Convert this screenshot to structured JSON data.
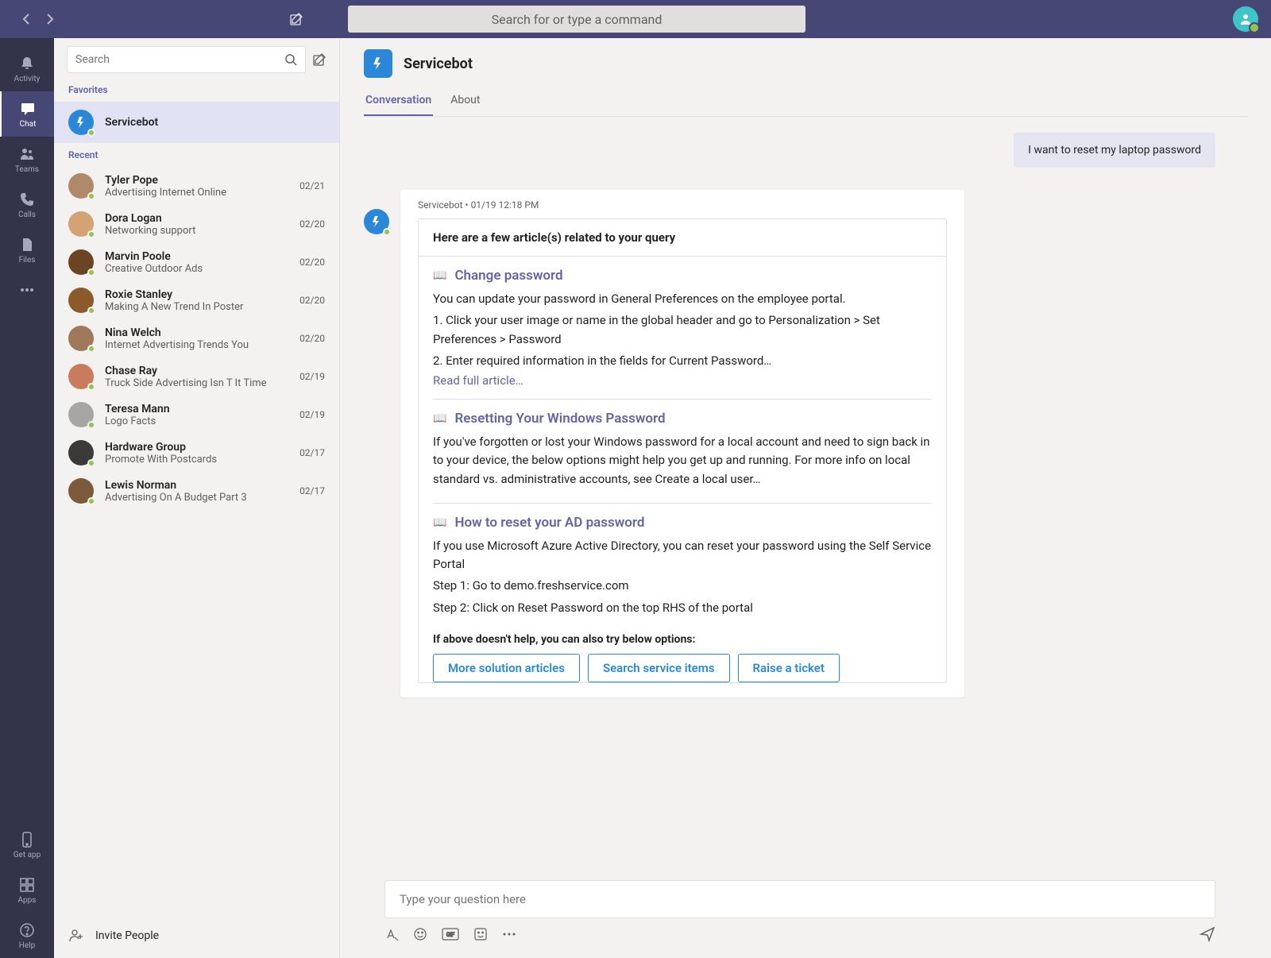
{
  "topbar": {
    "search_placeholder": "Search for or type a command"
  },
  "rail": [
    {
      "id": "activity",
      "label": "Activity"
    },
    {
      "id": "chat",
      "label": "Chat"
    },
    {
      "id": "teams",
      "label": "Teams"
    },
    {
      "id": "calls",
      "label": "Calls"
    },
    {
      "id": "files",
      "label": "Files"
    }
  ],
  "rail_bottom": [
    {
      "id": "getapp",
      "label": "Get app"
    },
    {
      "id": "apps",
      "label": "Apps"
    },
    {
      "id": "help",
      "label": "Help"
    }
  ],
  "chatlist": {
    "search_placeholder": "Search",
    "favorites_label": "Favorites",
    "recent_label": "Recent",
    "favorite": {
      "name": "Servicebot"
    },
    "recents": [
      {
        "name": "Tyler Pope",
        "preview": "Advertising Internet Online",
        "date": "02/21",
        "color": "#b08968"
      },
      {
        "name": "Dora Logan",
        "preview": "Networking support",
        "date": "02/20",
        "color": "#d4a373"
      },
      {
        "name": "Marvin Poole",
        "preview": "Creative Outdoor Ads",
        "date": "02/20",
        "color": "#6b4423"
      },
      {
        "name": "Roxie Stanley",
        "preview": "Making A New Trend In Poster",
        "date": "02/20",
        "color": "#8b5a2b"
      },
      {
        "name": "Nina Welch",
        "preview": "Internet Advertising Trends You",
        "date": "02/20",
        "color": "#a0785a"
      },
      {
        "name": "Chase Ray",
        "preview": "Truck Side Advertising Isn T It Time",
        "date": "02/19",
        "color": "#c97c5d"
      },
      {
        "name": "Teresa Mann",
        "preview": "Logo Facts",
        "date": "02/19",
        "color": "#a6a6a6"
      },
      {
        "name": "Hardware Group",
        "preview": "Promote With Postcards",
        "date": "02/17",
        "color": "#3a3a3a"
      },
      {
        "name": "Lewis Norman",
        "preview": "Advertising On A Budget Part 3",
        "date": "02/17",
        "color": "#7d5a3c"
      }
    ],
    "invite_label": "Invite People"
  },
  "conversation": {
    "title": "Servicebot",
    "tabs": [
      {
        "label": "Conversation",
        "active": true
      },
      {
        "label": "About",
        "active": false
      }
    ],
    "user_message": "I want to reset my laptop password",
    "bot_meta_name": "Servicebot",
    "bot_meta_time": "01/19 12:18 PM",
    "card_header": "Here are a few article(s) related to your query",
    "articles": [
      {
        "title": "Change password",
        "lines": [
          "You can update your password in General Preferences on the employee portal.",
          "1. Click your user image or name in the global header and go to Personalization > Set Preferences > Password",
          "2. Enter required information in the fields for Current Password…"
        ],
        "read_more": "Read full article…"
      },
      {
        "title": "Resetting Your Windows Password",
        "lines": [
          "If you've forgotten or lost your Windows password for a local account and need to sign back in to your device, the below options might help you get up and running. For more info on local standard vs. administrative accounts, see Create a local user…"
        ]
      },
      {
        "title": "How to reset your AD password",
        "lines": [
          "If you use Microsoft Azure Active Directory, you can reset your password using the Self Service Portal",
          "Step 1: Go to demo.freshservice.com",
          "Step 2: Click on Reset Password on the top RHS of the portal"
        ]
      }
    ],
    "options_header": "If above doesn't help, you can also try below options:",
    "option_buttons": [
      "More solution articles",
      "Search service items",
      "Raise a ticket"
    ],
    "compose_placeholder": "Type your question here"
  }
}
